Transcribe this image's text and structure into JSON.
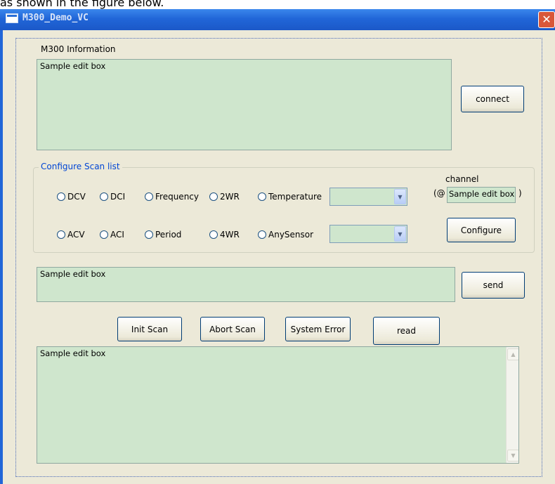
{
  "caption": "as shown in the figure below.",
  "window": {
    "title": "M300_Demo_VC",
    "close_glyph": "✕"
  },
  "info": {
    "label": "M300 Information",
    "text": "Sample edit box",
    "connect": "connect"
  },
  "scan": {
    "title": "Configure Scan list",
    "radios": {
      "dcv": "DCV",
      "dci": "DCI",
      "frequency": "Frequency",
      "twowr": "2WR",
      "temperature": "Temperature",
      "acv": "ACV",
      "aci": "ACI",
      "period": "Period",
      "fourwr": "4WR",
      "anysensor": "AnySensor"
    },
    "channel_label": "channel",
    "channel_prefix": "(@",
    "channel_value": "Sample edit box",
    "channel_suffix": ")",
    "configure": "Configure"
  },
  "command": {
    "text": "Sample edit box",
    "send": "send"
  },
  "actions": {
    "init_scan": "Init Scan",
    "abort_scan": "Abort Scan",
    "system_error": "System Error",
    "read": "read"
  },
  "output": {
    "text": "Sample edit box"
  },
  "colors": {
    "titlebar": "#2166d8",
    "edit_bg": "#cfe6cd",
    "dialog_bg": "#ece9d8",
    "group_title": "#0046d5",
    "close": "#d9573a"
  }
}
